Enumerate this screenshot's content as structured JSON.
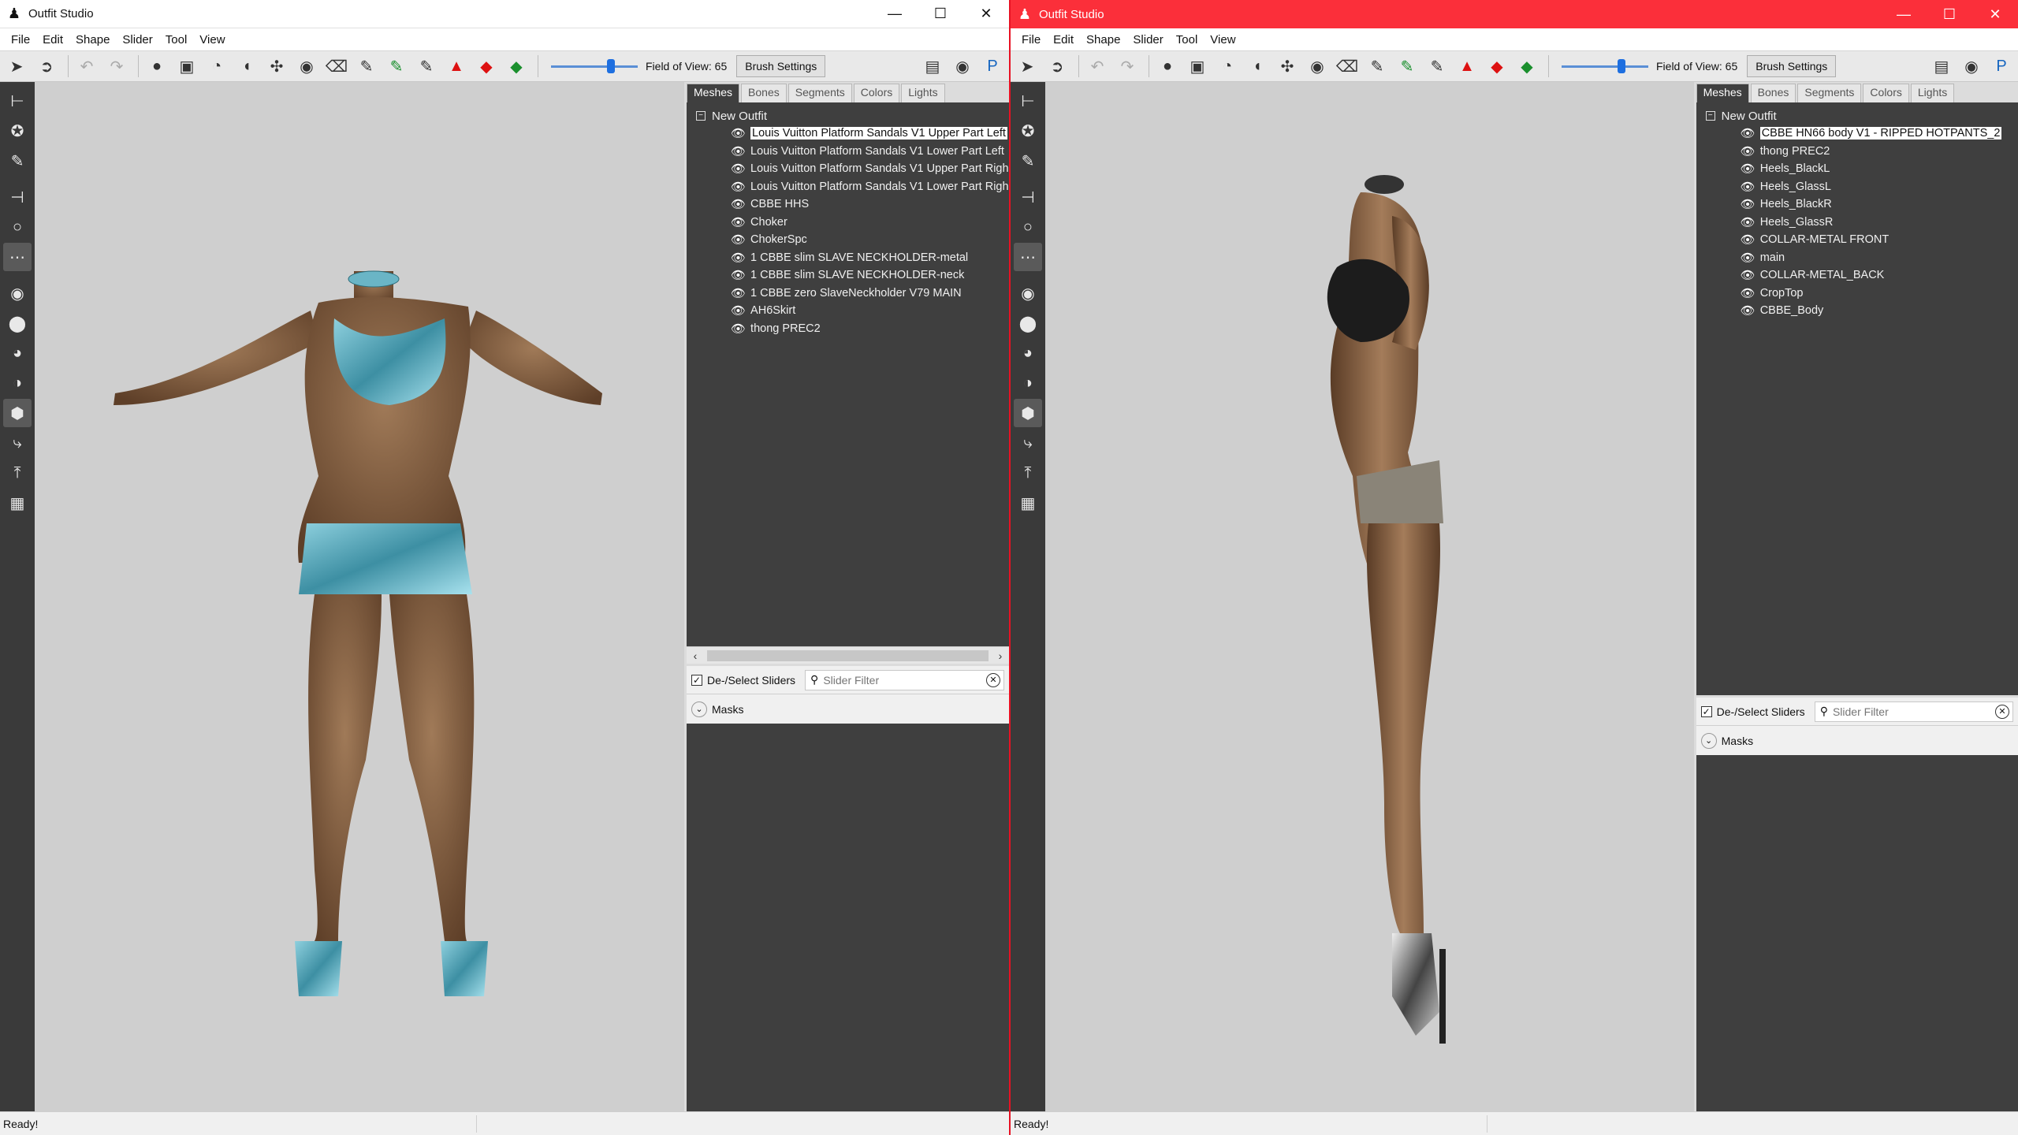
{
  "windows": [
    {
      "title": "Outfit Studio",
      "menu": [
        "File",
        "Edit",
        "Shape",
        "Slider",
        "Tool",
        "View"
      ],
      "toolbar": {
        "fov_label": "Field of View: 65",
        "brush_settings": "Brush Settings",
        "fov_value": 65
      },
      "tabs": [
        "Meshes",
        "Bones",
        "Segments",
        "Colors",
        "Lights"
      ],
      "tree_root": "New Outfit",
      "meshes": [
        "Louis Vuitton Platform Sandals V1 Upper Part Left",
        "Louis Vuitton Platform Sandals V1 Lower Part Left",
        "Louis Vuitton Platform Sandals V1 Upper Part Righ",
        "Louis Vuitton Platform Sandals V1 Lower Part Righ",
        "CBBE HHS",
        "Choker",
        "ChokerSpc",
        "1 CBBE slim SLAVE NECKHOLDER-metal",
        "1 CBBE slim SLAVE NECKHOLDER-neck",
        "1 CBBE zero SlaveNeckholder V79 MAIN",
        "AH6Skirt",
        "thong PREC2"
      ],
      "selected_mesh": 0,
      "deselect_sliders": "De-/Select Sliders",
      "slider_filter_placeholder": "Slider Filter",
      "masks": "Masks",
      "status": "Ready!"
    },
    {
      "title": "Outfit Studio",
      "menu": [
        "File",
        "Edit",
        "Shape",
        "Slider",
        "Tool",
        "View"
      ],
      "toolbar": {
        "fov_label": "Field of View: 65",
        "brush_settings": "Brush Settings",
        "fov_value": 65
      },
      "tabs": [
        "Meshes",
        "Bones",
        "Segments",
        "Colors",
        "Lights"
      ],
      "tree_root": "New Outfit",
      "meshes": [
        "CBBE HN66 body V1 - RIPPED HOTPANTS_2",
        "thong PREC2",
        "Heels_BlackL",
        "Heels_GlassL",
        "Heels_BlackR",
        "Heels_GlassR",
        "COLLAR-METAL FRONT",
        "main",
        "COLLAR-METAL_BACK",
        "CropTop",
        "CBBE_Body"
      ],
      "selected_mesh": 0,
      "deselect_sliders": "De-/Select Sliders",
      "slider_filter_placeholder": "Slider Filter",
      "masks": "Masks",
      "status": "Ready!"
    }
  ],
  "colors": {
    "active_titlebar": "#fb2f3a",
    "viewport_bg": "#cfcfcf",
    "panel_bg": "#3f3f3f",
    "skin": "#8a6444",
    "outfit_left": "#5aa6b8",
    "outfit_right_top": "#1c1c1c",
    "outfit_right_shorts": "#8a8478"
  }
}
